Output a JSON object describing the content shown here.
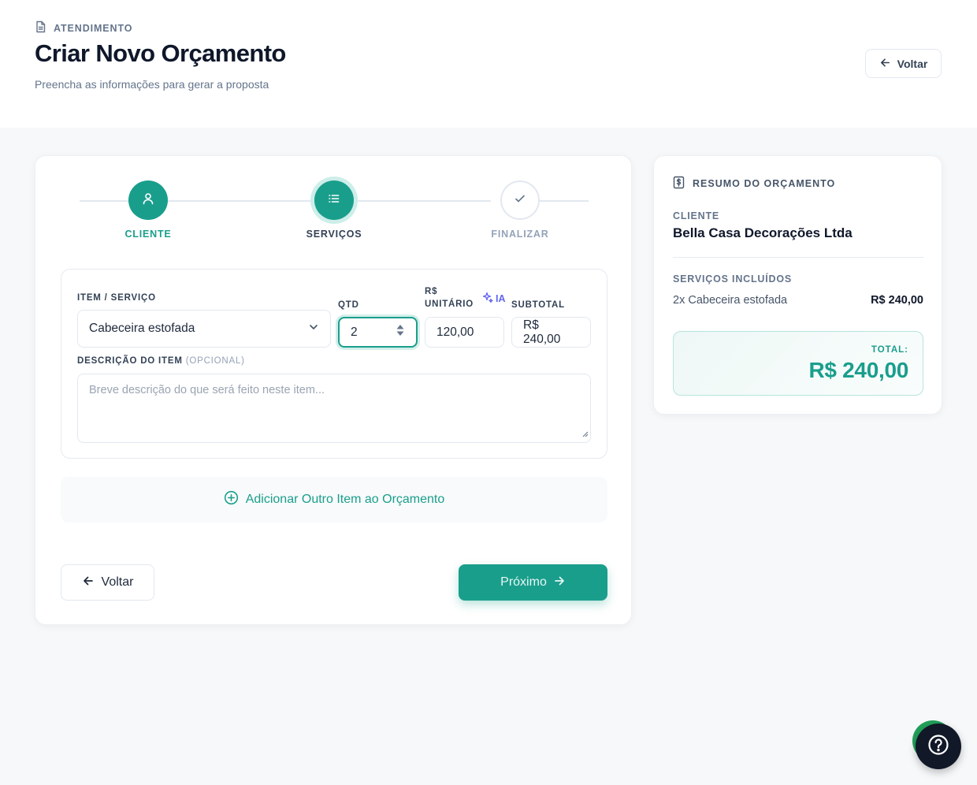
{
  "header": {
    "eyebrow": "ATENDIMENTO",
    "title": "Criar Novo Orçamento",
    "subtitle": "Preencha as informações para gerar a proposta",
    "back_label": "Voltar"
  },
  "steps": [
    {
      "label": "CLIENTE",
      "status": "done",
      "icon": "user-icon"
    },
    {
      "label": "SERVIÇOS",
      "status": "active",
      "icon": "list-icon"
    },
    {
      "label": "FINALIZAR",
      "status": "todo",
      "icon": "check-icon"
    }
  ],
  "item": {
    "item_label": "ITEM / SERVIÇO",
    "item_value": "Cabeceira estofada",
    "qty_label": "QTD",
    "qty_value": "2",
    "unit_label_line1": "R$",
    "unit_label_line2": "UNITÁRIO",
    "ai_label": "IA",
    "unit_value": "120,00",
    "subtotal_label": "SUBTOTAL",
    "subtotal_value": "R$ 240,00",
    "desc_label": "DESCRIÇÃO DO ITEM",
    "desc_optional": "(OPCIONAL)",
    "desc_placeholder": "Breve descrição do que será feito neste item..."
  },
  "actions": {
    "add_item": "Adicionar Outro Item ao Orçamento",
    "back": "Voltar",
    "next": "Próximo"
  },
  "summary": {
    "title": "RESUMO DO ORÇAMENTO",
    "client_label": "CLIENTE",
    "client_name": "Bella Casa Decorações Ltda",
    "services_label": "SERVIÇOS INCLUÍDOS",
    "services": [
      {
        "desc": "2x Cabeceira estofada",
        "price": "R$ 240,00"
      }
    ],
    "total_label": "TOTAL:",
    "total_value": "R$ 240,00"
  },
  "colors": {
    "accent": "#1a9e8c",
    "ai": "#6366f1",
    "help_fab": "#111827",
    "chat_fab": "#21a05a"
  }
}
